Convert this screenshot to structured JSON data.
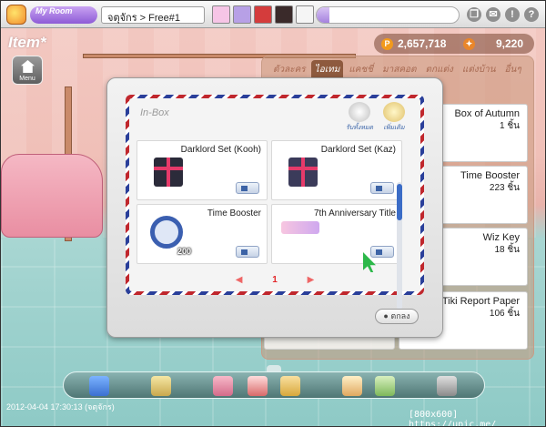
{
  "topbar": {
    "logo_text": "My Room",
    "room_name": "จตุจักร > Free#1",
    "avatar_colors": [
      "#f6c5e6",
      "#b7a0e6",
      "#d43c3c",
      "#3a2a2a",
      "#f5f5f5"
    ],
    "icons": [
      "window-icon",
      "gift-icon",
      "info-icon",
      "help-icon"
    ],
    "info_label": "!",
    "help_label": "?"
  },
  "page": {
    "title": "Item*",
    "menu_label": "Menu"
  },
  "currency": {
    "points": "2,657,718",
    "cash": "9,220",
    "points_icon": "P",
    "cash_icon": "✦"
  },
  "item_panel": {
    "tabs": [
      "ตัวละคร",
      "ไอเทม",
      "แคชชี่",
      "มาสคอต",
      "ตกแต่ง",
      "แต่งบ้าน",
      "อื่นๆ"
    ],
    "active_tab_index": 1,
    "items": [
      {
        "name": "Box of Autumn",
        "qty": "1 ชิ้น"
      },
      {
        "name": "Time Booster",
        "qty": "223 ชิ้น"
      },
      {
        "name": "Wiz Key",
        "qty": "18 ชิ้น"
      },
      {
        "name": "Tiki Report Paper",
        "qty": "106 ชิ้น"
      }
    ]
  },
  "inbox": {
    "title": "In-Box",
    "receive_all_label": "รับทั้งหมด",
    "delete_all_label": "เพิ่มเติม",
    "cells": [
      {
        "name": "Darklord Set (Kooh)",
        "color": "#2b2b3a"
      },
      {
        "name": "Darklord Set (Kaz)",
        "color": "#3b3b5a"
      },
      {
        "name": "Time Booster",
        "count": "200",
        "color": "#3b5fb0"
      },
      {
        "name": "7th Anniversary Title",
        "color": "#f5b6d3"
      }
    ],
    "page_number": "1",
    "prev_arrow": "◀",
    "next_arrow": "▶",
    "close_label": "● ตกลง"
  },
  "dock": {
    "icons": [
      "room-icon",
      "note-icon",
      "shop-icon",
      "home-icon",
      "puzzle-icon",
      "house-icon",
      "visit-icon",
      "exit-icon"
    ]
  },
  "footer": {
    "timestamp": "2012-04-04 17:30:13 (จตุจักร)",
    "watermark": "[800x600] https://upic.me/"
  }
}
